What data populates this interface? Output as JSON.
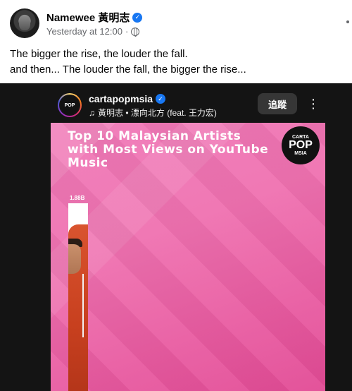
{
  "post": {
    "author": "Namewee 黃明志",
    "timestamp": "Yesterday at 12:00",
    "separator": "·",
    "caption_line1": "The bigger the rise, the louder the fall.",
    "caption_line2": "and then... The louder the fall, the bigger the rise..."
  },
  "reel": {
    "username": "cartapopmsia",
    "music": "黃明志 • 漂向北方 (feat. 王力宏)",
    "follow_label": "追蹤",
    "more_label": "⋮",
    "title": "Top 10 Malaysian Artists with Most Views on YouTube Music",
    "brand_top": "CARTA",
    "brand_mid": "POP",
    "brand_bottom": "MSIA",
    "bar_value_label": "1.88B",
    "bar_value": 1.88
  },
  "icons": {
    "verified": "✓",
    "music": "♫",
    "avatar_inner": "POP"
  },
  "colors": {
    "verified_blue": "#1877f2",
    "reel_pink": "#ef71b0",
    "media_bg": "#141414"
  }
}
